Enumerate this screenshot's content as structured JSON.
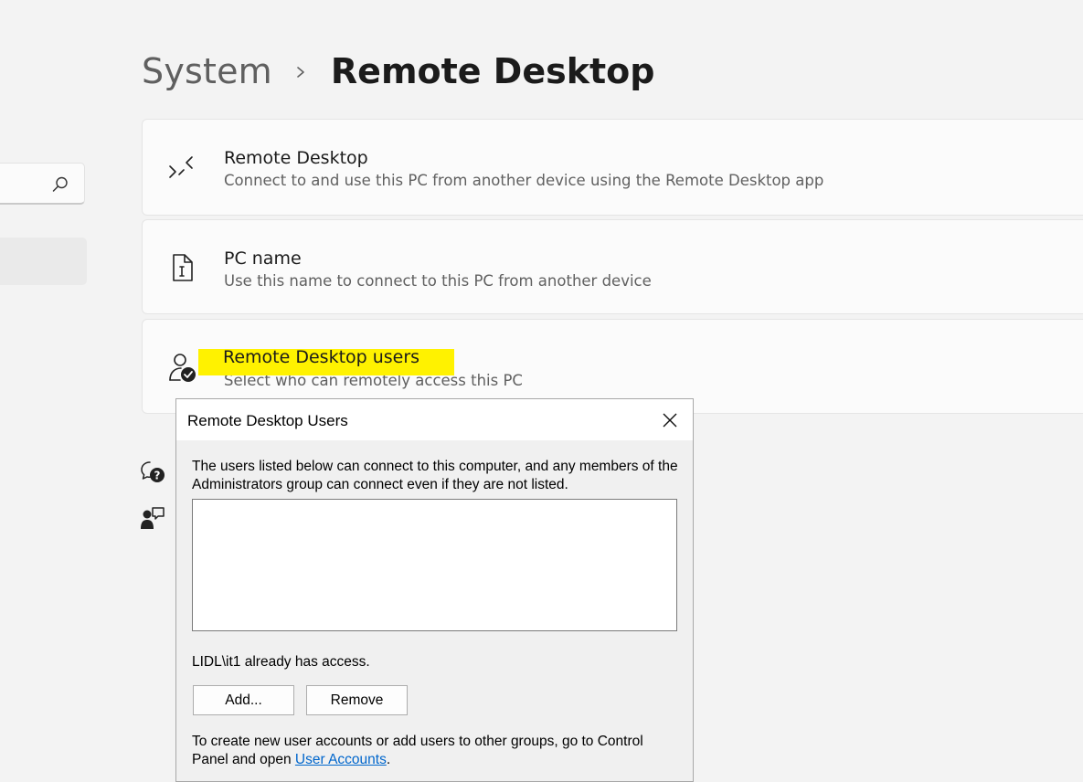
{
  "breadcrumb": {
    "parent": "System",
    "current": "Remote Desktop"
  },
  "cards": [
    {
      "icon": "remote-desktop-icon",
      "title": "Remote Desktop",
      "subtitle": "Connect to and use this PC from another device using the Remote Desktop app"
    },
    {
      "icon": "pc-name-icon",
      "title": "PC name",
      "subtitle": "Use this name to connect to this PC from another device"
    },
    {
      "icon": "user-check-icon",
      "title": "Remote Desktop users",
      "subtitle": "Select who can remotely access this PC"
    }
  ],
  "side_icons": [
    "get-help-icon",
    "feedback-icon"
  ],
  "dialog": {
    "title": "Remote Desktop Users",
    "intro": "The users listed below can connect to this computer, and any members of the Administrators group can connect even if they are not listed.",
    "users": [],
    "access_text": "LIDL\\it1 already has access.",
    "add_label": "Add...",
    "remove_label": "Remove",
    "footer_prefix": "To create new user accounts or add users to other groups, go to Control Panel and open ",
    "footer_link": "User Accounts",
    "footer_suffix": "."
  },
  "colors": {
    "background": "#f3f3f3",
    "card": "#fbfbfb",
    "highlight": "#fff200",
    "link": "#0066cc"
  }
}
